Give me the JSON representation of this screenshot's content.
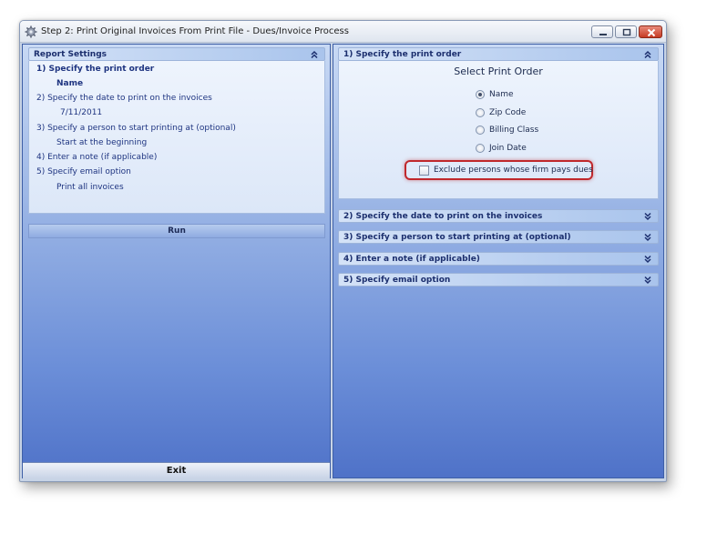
{
  "window": {
    "title": "Step 2: Print Original Invoices From Print File - Dues/Invoice Process"
  },
  "left_panel": {
    "header": "Report Settings",
    "items": [
      {
        "label": "1)  Specify the print order",
        "value": "Name"
      },
      {
        "label": "2)  Specify the date to print on the invoices",
        "value": "7/11/2011"
      },
      {
        "label": "3)  Specify a person to start printing at (optional)",
        "value": "Start at the beginning"
      },
      {
        "label": "4)  Enter a note (if applicable)",
        "value": ""
      },
      {
        "label": "5)  Specify email option",
        "value": "Print all invoices"
      }
    ],
    "run_label": "Run",
    "exit_label": "Exit"
  },
  "right_panel": {
    "section1": {
      "header": "1)  Specify the print order",
      "title": "Select Print Order",
      "options": [
        {
          "label": "Name",
          "selected": true
        },
        {
          "label": "Zip Code",
          "selected": false
        },
        {
          "label": "Billing Class",
          "selected": false
        },
        {
          "label": "Join Date",
          "selected": false
        }
      ],
      "checkbox_label": "Exclude persons whose firm pays dues",
      "checkbox_checked": false
    },
    "collapsed_sections": [
      {
        "header": "2)  Specify the date to print on the invoices"
      },
      {
        "header": "3)  Specify a person to start printing at (optional)"
      },
      {
        "header": "4)  Enter a note (if applicable)"
      },
      {
        "header": "5)  Specify email option"
      }
    ]
  },
  "icons": {
    "app": "gear-icon",
    "collapse": "double-chevron-up-icon",
    "expand": "double-chevron-down-icon",
    "minimize": "minimize-icon",
    "maximize": "maximize-icon",
    "close": "close-icon"
  },
  "colors": {
    "panel_gradient_top": "#c8d9f4",
    "panel_gradient_bottom": "#4f72c8",
    "highlight": "#c0282c"
  }
}
